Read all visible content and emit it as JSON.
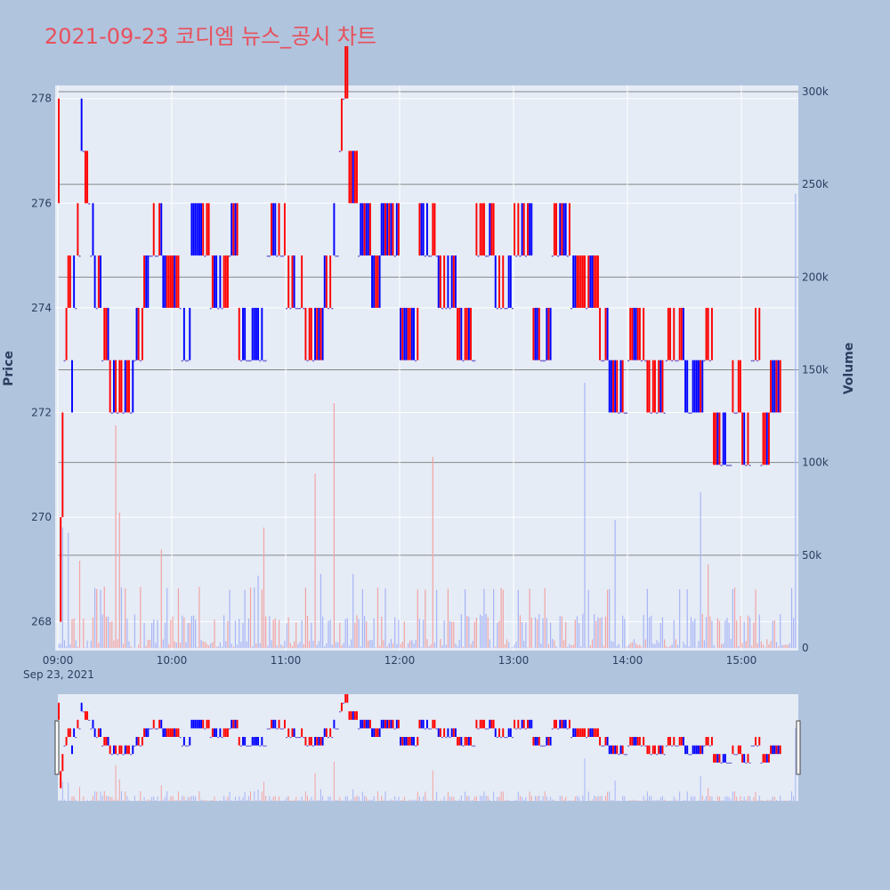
{
  "title": "2021-09-23 코디엠 뉴스_공시 차트",
  "colors": {
    "background": "#b0c4de",
    "plot_bg": "#e5ecf6",
    "title": "#e8505b",
    "up": "#ff0000",
    "down": "#0000ff",
    "volume_up": "#f2a3a3",
    "volume_down": "#a8b4f5",
    "axis_text": "#2a3f5f"
  },
  "chart_data": {
    "type": "candlestick",
    "x_axis": {
      "ticks": [
        "09:00",
        "10:00",
        "11:00",
        "12:00",
        "13:00",
        "14:00",
        "15:00"
      ],
      "sub_label": "Sep 23, 2021"
    },
    "price_axis": {
      "label": "Price",
      "ticks": [
        268,
        270,
        272,
        274,
        276,
        278
      ],
      "range": [
        267.45,
        278.25
      ]
    },
    "volume_axis": {
      "label": "Volume",
      "ticks": [
        "0",
        "50k",
        "100k",
        "150k",
        "200k",
        "250k",
        "300k"
      ],
      "tick_values": [
        0,
        50000,
        100000,
        150000,
        200000,
        250000,
        300000
      ],
      "range": [
        0,
        300000
      ]
    },
    "price_path": [
      [
        "09:00",
        277
      ],
      [
        "09:01",
        269
      ],
      [
        "09:02",
        271
      ],
      [
        "09:03",
        273
      ],
      [
        "09:05",
        274
      ],
      [
        "09:07",
        272
      ],
      [
        "09:08",
        274
      ],
      [
        "09:10",
        275
      ],
      [
        "09:12",
        277
      ],
      [
        "09:14",
        276
      ],
      [
        "09:17",
        275
      ],
      [
        "09:19",
        274
      ],
      [
        "09:23",
        273
      ],
      [
        "09:27",
        272
      ],
      [
        "09:33",
        272
      ],
      [
        "09:40",
        273
      ],
      [
        "09:45",
        274
      ],
      [
        "09:48",
        275
      ],
      [
        "09:55",
        274
      ],
      [
        "10:05",
        273
      ],
      [
        "10:10",
        275
      ],
      [
        "10:20",
        274
      ],
      [
        "10:30",
        275
      ],
      [
        "10:35",
        273
      ],
      [
        "10:50",
        275
      ],
      [
        "11:00",
        274
      ],
      [
        "11:10",
        273
      ],
      [
        "11:20",
        274
      ],
      [
        "11:25",
        275
      ],
      [
        "11:28",
        277
      ],
      [
        "11:30",
        278
      ],
      [
        "11:33",
        276
      ],
      [
        "11:38",
        275
      ],
      [
        "11:45",
        274
      ],
      [
        "11:50",
        275
      ],
      [
        "12:00",
        273
      ],
      [
        "12:10",
        275
      ],
      [
        "12:20",
        274
      ],
      [
        "12:30",
        273
      ],
      [
        "12:40",
        275
      ],
      [
        "12:50",
        274
      ],
      [
        "13:00",
        275
      ],
      [
        "13:10",
        273
      ],
      [
        "13:20",
        275
      ],
      [
        "13:30",
        274
      ],
      [
        "13:45",
        273
      ],
      [
        "13:50",
        272
      ],
      [
        "14:00",
        273
      ],
      [
        "14:10",
        272
      ],
      [
        "14:20",
        273
      ],
      [
        "14:30",
        272
      ],
      [
        "14:40",
        273
      ],
      [
        "14:45",
        271
      ],
      [
        "14:55",
        272
      ],
      [
        "15:00",
        271
      ],
      [
        "15:05",
        273
      ],
      [
        "15:10",
        271
      ],
      [
        "15:15",
        272
      ],
      [
        "15:20",
        272
      ]
    ],
    "volume_spikes": [
      [
        "09:02",
        65000
      ],
      [
        "09:05",
        62000
      ],
      [
        "09:11",
        47000
      ],
      [
        "09:24",
        33000
      ],
      [
        "09:30",
        120000
      ],
      [
        "09:32",
        73000
      ],
      [
        "09:54",
        53000
      ],
      [
        "10:45",
        39000
      ],
      [
        "10:48",
        65000
      ],
      [
        "11:15",
        94000
      ],
      [
        "11:18",
        40000
      ],
      [
        "11:25",
        132000
      ],
      [
        "11:35",
        40000
      ],
      [
        "12:17",
        103000
      ],
      [
        "13:37",
        143000
      ],
      [
        "13:53",
        69000
      ],
      [
        "14:38",
        84000
      ],
      [
        "14:42",
        45000
      ],
      [
        "15:28",
        245000
      ]
    ]
  }
}
